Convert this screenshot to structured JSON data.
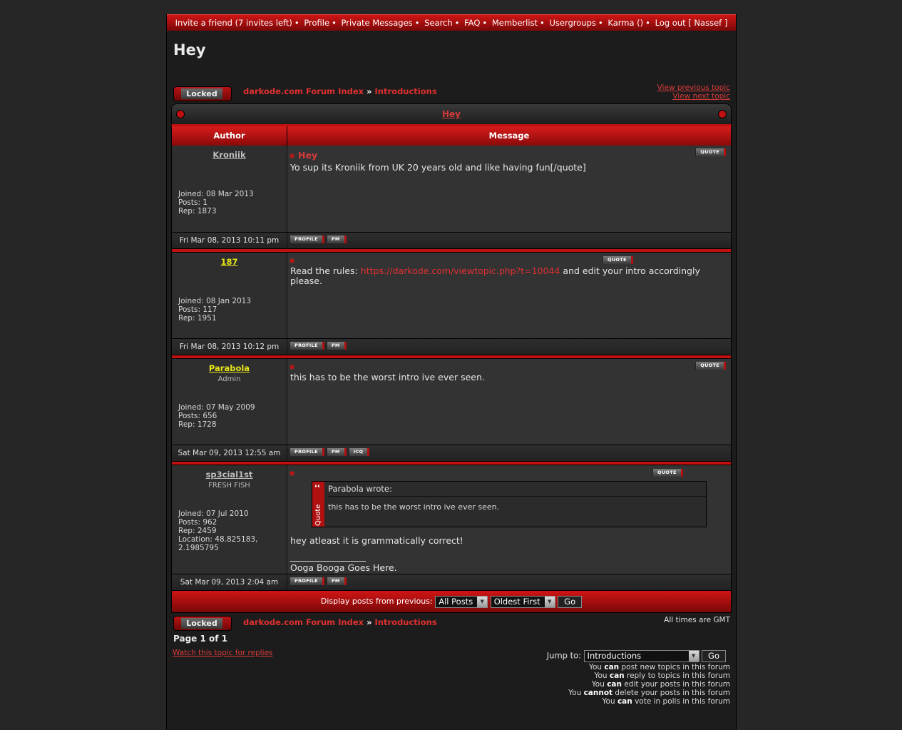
{
  "topnav": {
    "invite": "Invite a friend (7 invites left)",
    "profile": "Profile",
    "pm": "Private Messages",
    "search": "Search",
    "faq": "FAQ",
    "memberlist": "Memberlist",
    "usergroups": "Usergroups",
    "karma": "Karma ()",
    "logout": "Log out [ Nassef ]"
  },
  "page_title": "Hey",
  "locked_label": "Locked",
  "breadcrumb": {
    "forum_index": "darkode.com Forum Index",
    "sep": "»",
    "forum": "Introductions"
  },
  "nav": {
    "prev": "View previous topic",
    "next": "View next topic"
  },
  "topic_title": "Hey",
  "headers": {
    "author": "Author",
    "message": "Message"
  },
  "buttons": {
    "quote": "QUOTE",
    "profile": "PROFILE",
    "pm": "PM",
    "icq": "ICQ"
  },
  "posts": [
    {
      "author": "Kroniik",
      "author_color": "#bdbdbd",
      "rank": "",
      "joined": "Joined: 08 Mar 2013",
      "posts": "Posts: 1",
      "rep": "Rep: 1873",
      "location": "",
      "subject": "Hey",
      "body": "Yo sup its Kroniik from UK 20 years old and like having fun[/quote]",
      "date": "Fri Mar 08, 2013 10:11 pm"
    },
    {
      "author": "187",
      "author_color": "#e6e61a",
      "rank": "",
      "joined": "Joined: 08 Jan 2013",
      "posts": "Posts: 117",
      "rep": "Rep: 1951",
      "location": "",
      "subject": "",
      "body_pre": "Read the rules: ",
      "body_link": "https://darkode.com/viewtopic.php?t=10044",
      "body_post": " and edit your intro accordingly please.",
      "date": "Fri Mar 08, 2013 10:12 pm"
    },
    {
      "author": "Parabola",
      "author_color": "#e6e61a",
      "rank": "Admin",
      "joined": "Joined: 07 May 2009",
      "posts": "Posts: 656",
      "rep": "Rep: 1728",
      "location": "",
      "subject": "",
      "body": "this has to be the worst intro ive ever seen.",
      "date": "Sat Mar 09, 2013 12:55 am"
    },
    {
      "author": "sp3cial1st",
      "author_color": "#bdbdbd",
      "rank": "FRESH FISH",
      "joined": "Joined: 07 Jul 2010",
      "posts": "Posts: 962",
      "rep": "Rep: 2459",
      "location": "Location: 48.825183, 2.1985795",
      "subject": "",
      "quote_title": "Parabola wrote:",
      "quote_body": "this has to be the worst intro ive ever seen.",
      "quote_label": "Quote",
      "body": "hey atleast it is grammatically correct!",
      "sig_line": "_________________",
      "signature": "Ooga Booga Goes Here.",
      "date": "Sat Mar 09, 2013 2:04 am"
    }
  ],
  "display": {
    "label": "Display posts from previous:",
    "posts_value": "All Posts",
    "order_value": "Oldest First",
    "go": "Go"
  },
  "timezone": "All times are GMT",
  "page_info": "Page 1 of 1",
  "watch": "Watch this topic for replies",
  "jump": {
    "label": "Jump to:",
    "value": "Introductions",
    "go": "Go"
  },
  "permissions": [
    {
      "pre": "You ",
      "bold": "can",
      "post": " post new topics in this forum"
    },
    {
      "pre": "You ",
      "bold": "can",
      "post": " reply to topics in this forum"
    },
    {
      "pre": "You ",
      "bold": "can",
      "post": " edit your posts in this forum"
    },
    {
      "pre": "You ",
      "bold": "cannot",
      "post": " delete your posts in this forum"
    },
    {
      "pre": "You ",
      "bold": "can",
      "post": " vote in polls in this forum"
    }
  ],
  "colors": {
    "accent": "#c01010",
    "link": "#d93a3a",
    "background": "#1c1c1c"
  }
}
